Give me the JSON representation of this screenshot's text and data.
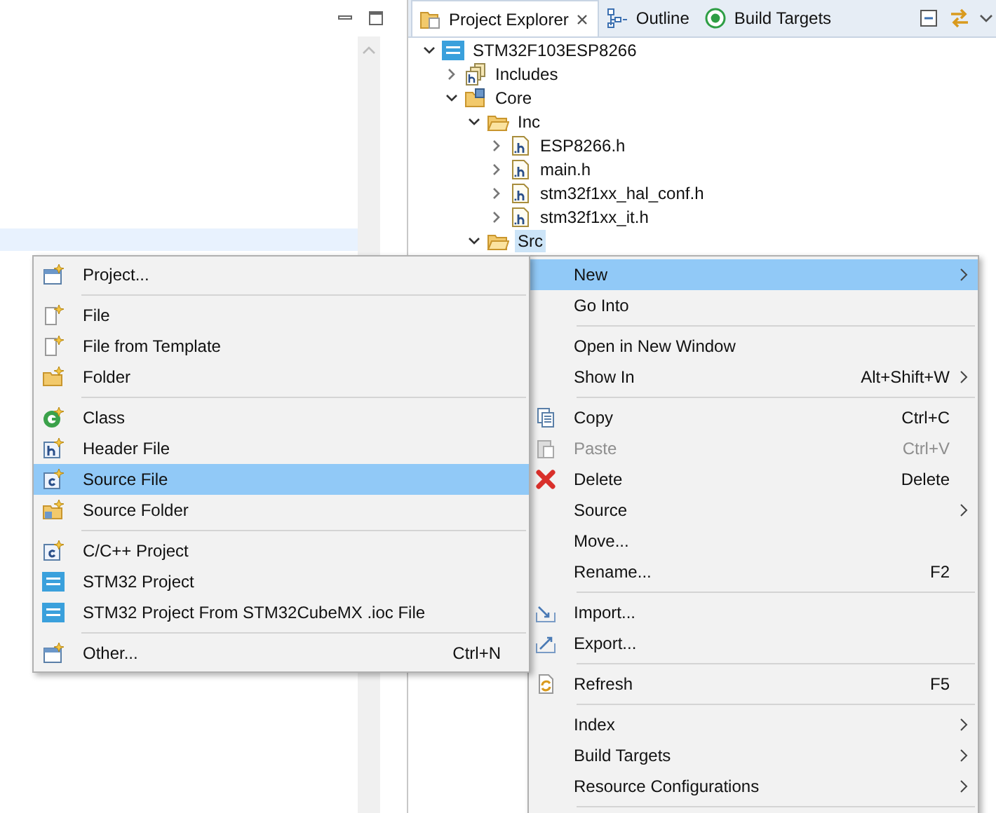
{
  "explorer": {
    "tabs": [
      {
        "label": "Project Explorer",
        "selected": true,
        "closable": true,
        "kind": "explorer"
      },
      {
        "label": "Outline",
        "selected": false,
        "closable": false,
        "kind": "outline"
      },
      {
        "label": "Build Targets",
        "selected": false,
        "closable": false,
        "kind": "targets"
      }
    ],
    "tree": [
      {
        "label": "STM32F103ESP8266",
        "kind": "project",
        "expanded": true,
        "selected": false,
        "children": [
          {
            "label": "Includes",
            "kind": "includes",
            "expanded": false,
            "selected": false
          },
          {
            "label": "Core",
            "kind": "source-folder",
            "expanded": true,
            "selected": false,
            "children": [
              {
                "label": "Inc",
                "kind": "folder",
                "expanded": true,
                "selected": false,
                "children": [
                  {
                    "label": "ESP8266.h",
                    "kind": "header",
                    "expanded": false,
                    "selected": false
                  },
                  {
                    "label": "main.h",
                    "kind": "header",
                    "expanded": false,
                    "selected": false
                  },
                  {
                    "label": "stm32f1xx_hal_conf.h",
                    "kind": "header",
                    "expanded": false,
                    "selected": false
                  },
                  {
                    "label": "stm32f1xx_it.h",
                    "kind": "header",
                    "expanded": false,
                    "selected": false
                  }
                ]
              },
              {
                "label": "Src",
                "kind": "folder",
                "expanded": true,
                "selected": true
              }
            ]
          }
        ]
      }
    ]
  },
  "new_submenu": {
    "groups": [
      [
        {
          "label": "Project...",
          "kind": "new-project",
          "selected": false,
          "disabled": false
        }
      ],
      [
        {
          "label": "File",
          "kind": "new-file",
          "selected": false,
          "disabled": false
        },
        {
          "label": "File from Template",
          "kind": "new-file",
          "selected": false,
          "disabled": false
        },
        {
          "label": "Folder",
          "kind": "new-folder",
          "selected": false,
          "disabled": false
        }
      ],
      [
        {
          "label": "Class",
          "kind": "new-class",
          "selected": false,
          "disabled": false
        },
        {
          "label": "Header File",
          "kind": "new-header",
          "selected": false,
          "disabled": false
        },
        {
          "label": "Source File",
          "kind": "new-source",
          "selected": true,
          "disabled": false
        },
        {
          "label": "Source Folder",
          "kind": "new-source-folder",
          "selected": false,
          "disabled": false
        }
      ],
      [
        {
          "label": "C/C++ Project",
          "kind": "new-cpp-project",
          "selected": false,
          "disabled": false
        },
        {
          "label": "STM32 Project",
          "kind": "ide",
          "selected": false,
          "disabled": false
        },
        {
          "label": "STM32 Project From STM32CubeMX .ioc File",
          "kind": "mx",
          "selected": false,
          "disabled": false
        }
      ],
      [
        {
          "label": "Other...",
          "kind": "new-project",
          "shortcut": "Ctrl+N",
          "selected": false,
          "disabled": false
        }
      ]
    ]
  },
  "context_menu": {
    "groups": [
      [
        {
          "label": "New",
          "kind": "blank",
          "submenu": true,
          "selected": true,
          "disabled": false
        },
        {
          "label": "Go Into",
          "kind": "blank",
          "submenu": false,
          "selected": false,
          "disabled": false
        }
      ],
      [
        {
          "label": "Open in New Window",
          "kind": "blank",
          "submenu": false,
          "selected": false,
          "disabled": false
        },
        {
          "label": "Show In",
          "kind": "blank",
          "shortcut": "Alt+Shift+W",
          "submenu": true,
          "selected": false,
          "disabled": false
        }
      ],
      [
        {
          "label": "Copy",
          "kind": "copy",
          "shortcut": "Ctrl+C",
          "submenu": false,
          "selected": false,
          "disabled": false
        },
        {
          "label": "Paste",
          "kind": "paste",
          "shortcut": "Ctrl+V",
          "submenu": false,
          "selected": false,
          "disabled": true
        },
        {
          "label": "Delete",
          "kind": "delete",
          "shortcut": "Delete",
          "submenu": false,
          "selected": false,
          "disabled": false
        },
        {
          "label": "Source",
          "kind": "blank",
          "submenu": true,
          "selected": false,
          "disabled": false
        },
        {
          "label": "Move...",
          "kind": "blank",
          "submenu": false,
          "selected": false,
          "disabled": false
        },
        {
          "label": "Rename...",
          "kind": "blank",
          "shortcut": "F2",
          "submenu": false,
          "selected": false,
          "disabled": false
        }
      ],
      [
        {
          "label": "Import...",
          "kind": "import",
          "submenu": false,
          "selected": false,
          "disabled": false
        },
        {
          "label": "Export...",
          "kind": "export",
          "submenu": false,
          "selected": false,
          "disabled": false
        }
      ],
      [
        {
          "label": "Refresh",
          "kind": "refresh",
          "shortcut": "F5",
          "submenu": false,
          "selected": false,
          "disabled": false
        }
      ],
      [
        {
          "label": "Index",
          "kind": "blank",
          "submenu": true,
          "selected": false,
          "disabled": false
        },
        {
          "label": "Build Targets",
          "kind": "blank",
          "submenu": true,
          "selected": false,
          "disabled": false
        },
        {
          "label": "Resource Configurations",
          "kind": "blank",
          "submenu": true,
          "selected": false,
          "disabled": false
        }
      ]
    ]
  }
}
